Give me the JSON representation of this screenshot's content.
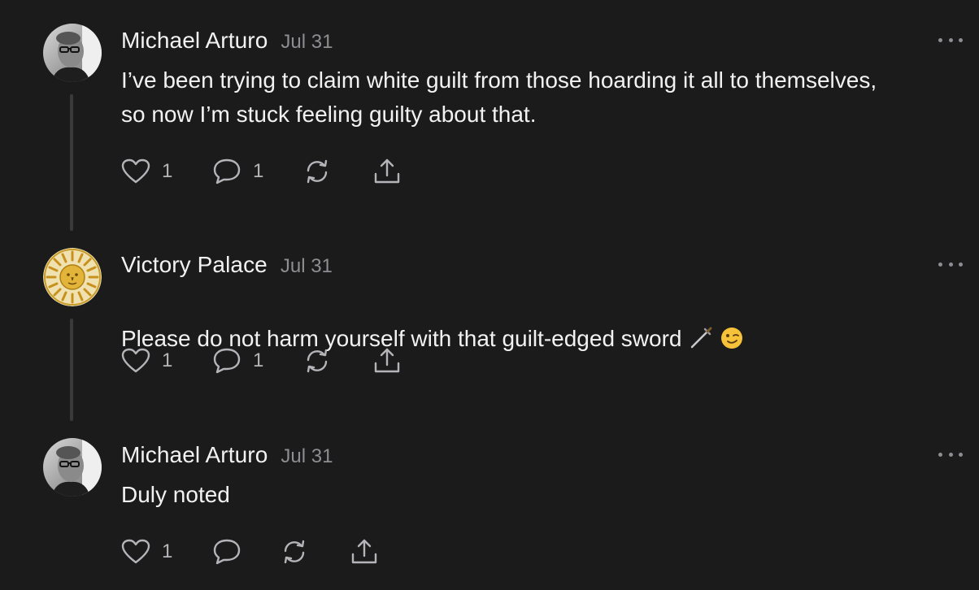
{
  "comments": [
    {
      "author": "Michael Arturo",
      "date": "Jul 31",
      "text": "I’ve been trying to claim white guilt from those hoarding it all to themselves,\nso now I’m stuck feeling guilty about that.",
      "avatar_icon": "person-photo-avatar",
      "likes": "1",
      "replies": "1"
    },
    {
      "author": "Victory Palace",
      "date": "Jul 31",
      "text": "Please do not harm yourself with that guilt-edged sword",
      "emoji_icons": [
        "dagger-icon",
        "winking-face-icon"
      ],
      "avatar_icon": "golden-sun-avatar",
      "likes": "1",
      "replies": "1"
    },
    {
      "author": "Michael Arturo",
      "date": "Jul 31",
      "text": "Duly noted",
      "avatar_icon": "person-photo-avatar",
      "likes": "1",
      "replies": ""
    }
  ],
  "colors": {
    "background": "#1b1b1c",
    "text": "#f2f2f2",
    "muted": "#8d8d92",
    "thread_line": "#3a3a3c",
    "sun_gold": "#e3b43a"
  },
  "icons": {
    "like": "heart-icon",
    "reply": "speech-bubble-icon",
    "restack": "restack-arrows-icon",
    "share": "share-upload-icon",
    "more": "more-dots-icon"
  }
}
